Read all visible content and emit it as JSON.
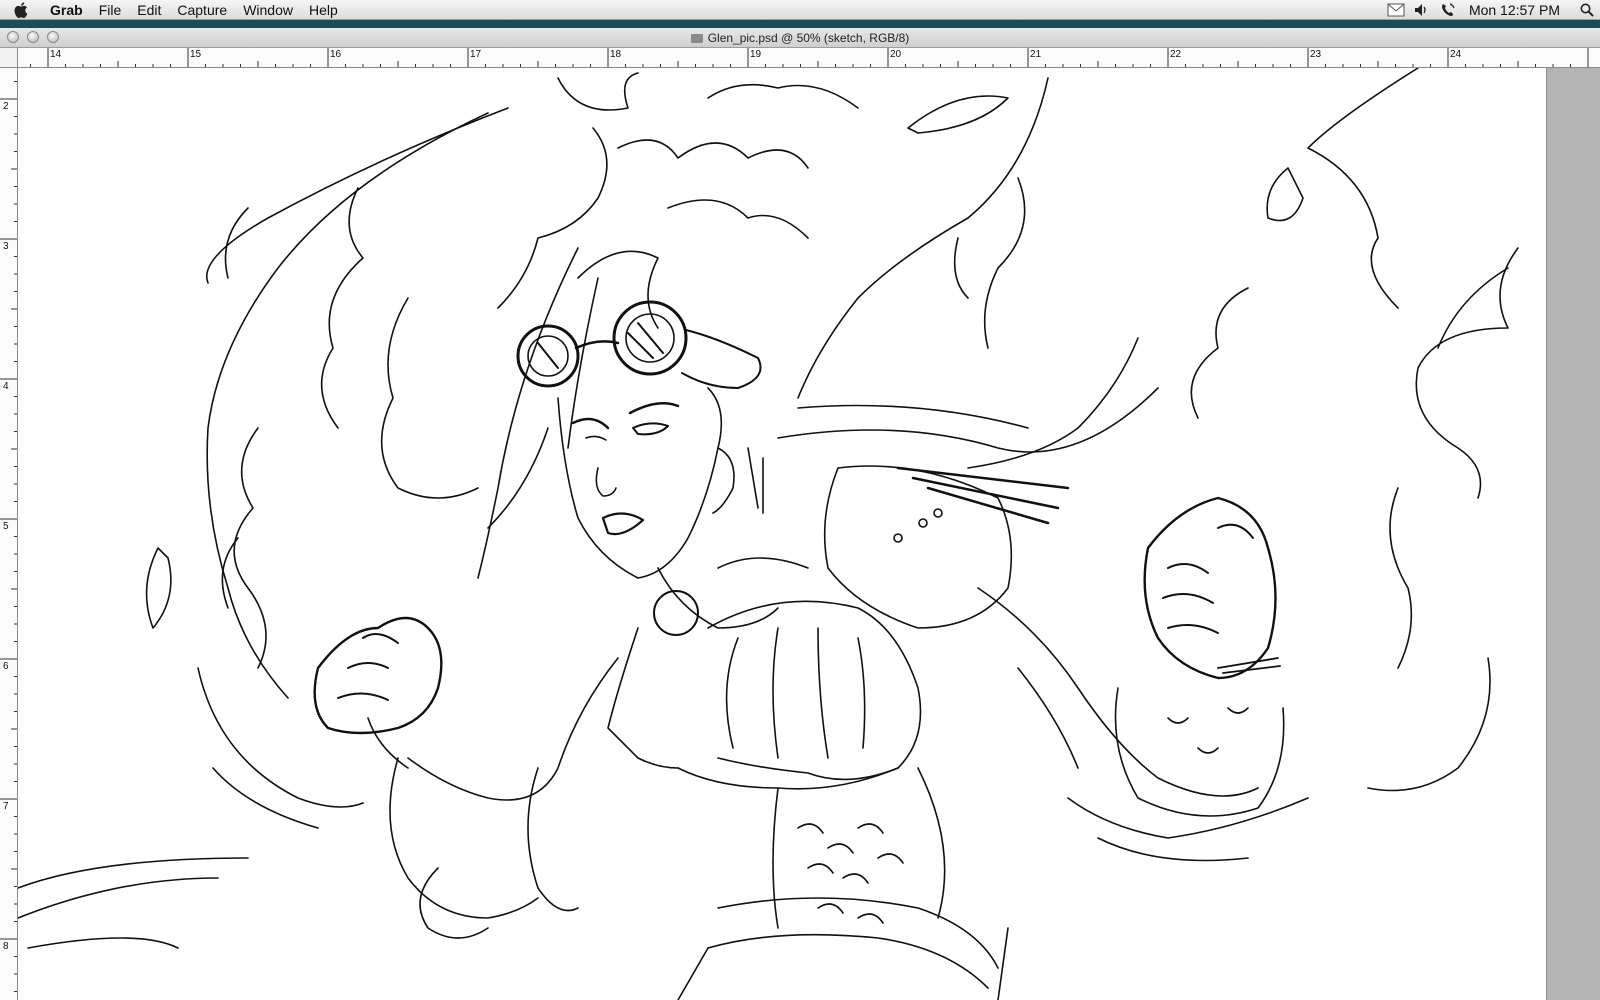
{
  "menubar": {
    "app_name": "Grab",
    "items": [
      "File",
      "Edit",
      "Capture",
      "Window",
      "Help"
    ],
    "status_icons": [
      "mail-icon",
      "volume-icon",
      "phone-icon"
    ],
    "clock": "Mon 12:57 PM"
  },
  "window": {
    "title": "Glen_pic.psd @ 50% (sketch, RGB/8)"
  },
  "rulers": {
    "horizontal": [
      "14",
      "15",
      "16",
      "17",
      "18",
      "19",
      "20",
      "21",
      "22",
      "23",
      "24"
    ],
    "vertical": [
      "2",
      "3",
      "4",
      "5",
      "6",
      "7",
      "8"
    ]
  },
  "colors": {
    "menubar_accent": "#1c4b5a",
    "pasteboard": "#b4b4b4",
    "ink": "#111111"
  },
  "canvas": {
    "content": "pencil sketch artwork"
  }
}
